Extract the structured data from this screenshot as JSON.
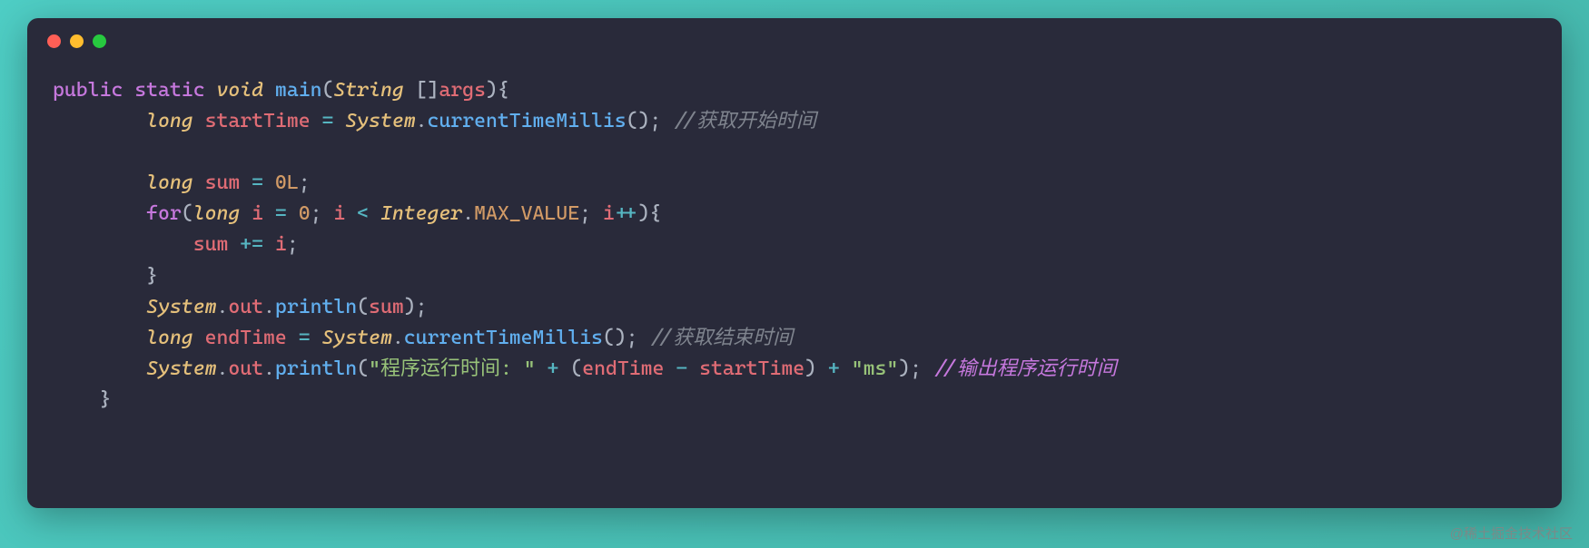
{
  "code": {
    "tokens": [
      {
        "t": "public",
        "c": "kw"
      },
      {
        "t": " ",
        "c": "punct"
      },
      {
        "t": "static",
        "c": "kw"
      },
      {
        "t": " ",
        "c": "punct"
      },
      {
        "t": "void",
        "c": "type"
      },
      {
        "t": " ",
        "c": "punct"
      },
      {
        "t": "main",
        "c": "fn"
      },
      {
        "t": "(",
        "c": "punct"
      },
      {
        "t": "String",
        "c": "type"
      },
      {
        "t": " []",
        "c": "punct"
      },
      {
        "t": "args",
        "c": "var"
      },
      {
        "t": "){",
        "c": "punct"
      },
      {
        "t": "\n",
        "c": ""
      },
      {
        "t": "        ",
        "c": "punct"
      },
      {
        "t": "long",
        "c": "type"
      },
      {
        "t": " ",
        "c": "punct"
      },
      {
        "t": "startTime",
        "c": "var"
      },
      {
        "t": " ",
        "c": "punct"
      },
      {
        "t": "=",
        "c": "op"
      },
      {
        "t": " ",
        "c": "punct"
      },
      {
        "t": "System",
        "c": "type"
      },
      {
        "t": ".",
        "c": "punct"
      },
      {
        "t": "currentTimeMillis",
        "c": "fn"
      },
      {
        "t": "(); ",
        "c": "punct"
      },
      {
        "t": "//获取开始时间",
        "c": "cmt"
      },
      {
        "t": "\n",
        "c": ""
      },
      {
        "t": "\n",
        "c": ""
      },
      {
        "t": "        ",
        "c": "punct"
      },
      {
        "t": "long",
        "c": "type"
      },
      {
        "t": " ",
        "c": "punct"
      },
      {
        "t": "sum",
        "c": "var"
      },
      {
        "t": " ",
        "c": "punct"
      },
      {
        "t": "=",
        "c": "op"
      },
      {
        "t": " ",
        "c": "punct"
      },
      {
        "t": "0L",
        "c": "num"
      },
      {
        "t": ";",
        "c": "punct"
      },
      {
        "t": "\n",
        "c": ""
      },
      {
        "t": "        ",
        "c": "punct"
      },
      {
        "t": "for",
        "c": "kw"
      },
      {
        "t": "(",
        "c": "punct"
      },
      {
        "t": "long",
        "c": "type"
      },
      {
        "t": " ",
        "c": "punct"
      },
      {
        "t": "i",
        "c": "var"
      },
      {
        "t": " ",
        "c": "punct"
      },
      {
        "t": "=",
        "c": "op"
      },
      {
        "t": " ",
        "c": "punct"
      },
      {
        "t": "0",
        "c": "num"
      },
      {
        "t": "; ",
        "c": "punct"
      },
      {
        "t": "i",
        "c": "var"
      },
      {
        "t": " ",
        "c": "punct"
      },
      {
        "t": "<",
        "c": "op"
      },
      {
        "t": " ",
        "c": "punct"
      },
      {
        "t": "Integer",
        "c": "type"
      },
      {
        "t": ".",
        "c": "punct"
      },
      {
        "t": "MAX_VALUE",
        "c": "const"
      },
      {
        "t": "; ",
        "c": "punct"
      },
      {
        "t": "i",
        "c": "var"
      },
      {
        "t": "++",
        "c": "op"
      },
      {
        "t": "){",
        "c": "punct"
      },
      {
        "t": "\n",
        "c": ""
      },
      {
        "t": "            ",
        "c": "punct"
      },
      {
        "t": "sum",
        "c": "var"
      },
      {
        "t": " ",
        "c": "punct"
      },
      {
        "t": "+=",
        "c": "op"
      },
      {
        "t": " ",
        "c": "punct"
      },
      {
        "t": "i",
        "c": "var"
      },
      {
        "t": ";",
        "c": "punct"
      },
      {
        "t": "\n",
        "c": ""
      },
      {
        "t": "        }",
        "c": "punct"
      },
      {
        "t": "\n",
        "c": ""
      },
      {
        "t": "        ",
        "c": "punct"
      },
      {
        "t": "System",
        "c": "type"
      },
      {
        "t": ".",
        "c": "punct"
      },
      {
        "t": "out",
        "c": "var"
      },
      {
        "t": ".",
        "c": "punct"
      },
      {
        "t": "println",
        "c": "fn"
      },
      {
        "t": "(",
        "c": "punct"
      },
      {
        "t": "sum",
        "c": "var"
      },
      {
        "t": ");",
        "c": "punct"
      },
      {
        "t": "\n",
        "c": ""
      },
      {
        "t": "        ",
        "c": "punct"
      },
      {
        "t": "long",
        "c": "type"
      },
      {
        "t": " ",
        "c": "punct"
      },
      {
        "t": "endTime",
        "c": "var"
      },
      {
        "t": " ",
        "c": "punct"
      },
      {
        "t": "=",
        "c": "op"
      },
      {
        "t": " ",
        "c": "punct"
      },
      {
        "t": "System",
        "c": "type"
      },
      {
        "t": ".",
        "c": "punct"
      },
      {
        "t": "currentTimeMillis",
        "c": "fn"
      },
      {
        "t": "(); ",
        "c": "punct"
      },
      {
        "t": "//获取结束时间",
        "c": "cmt"
      },
      {
        "t": "\n",
        "c": ""
      },
      {
        "t": "        ",
        "c": "punct"
      },
      {
        "t": "System",
        "c": "type"
      },
      {
        "t": ".",
        "c": "punct"
      },
      {
        "t": "out",
        "c": "var"
      },
      {
        "t": ".",
        "c": "punct"
      },
      {
        "t": "println",
        "c": "fn"
      },
      {
        "t": "(",
        "c": "punct"
      },
      {
        "t": "\"程序运行时间: \"",
        "c": "str"
      },
      {
        "t": " ",
        "c": "punct"
      },
      {
        "t": "+",
        "c": "op"
      },
      {
        "t": " (",
        "c": "punct"
      },
      {
        "t": "endTime",
        "c": "var"
      },
      {
        "t": " ",
        "c": "punct"
      },
      {
        "t": "-",
        "c": "op"
      },
      {
        "t": " ",
        "c": "punct"
      },
      {
        "t": "startTime",
        "c": "var"
      },
      {
        "t": ") ",
        "c": "punct"
      },
      {
        "t": "+",
        "c": "op"
      },
      {
        "t": " ",
        "c": "punct"
      },
      {
        "t": "\"ms\"",
        "c": "str"
      },
      {
        "t": "); ",
        "c": "punct"
      },
      {
        "t": "//输出程序运行时间",
        "c": "cmt2"
      },
      {
        "t": "\n",
        "c": ""
      },
      {
        "t": "    }",
        "c": "punct"
      }
    ]
  },
  "watermark": "@稀土掘金技术社区"
}
